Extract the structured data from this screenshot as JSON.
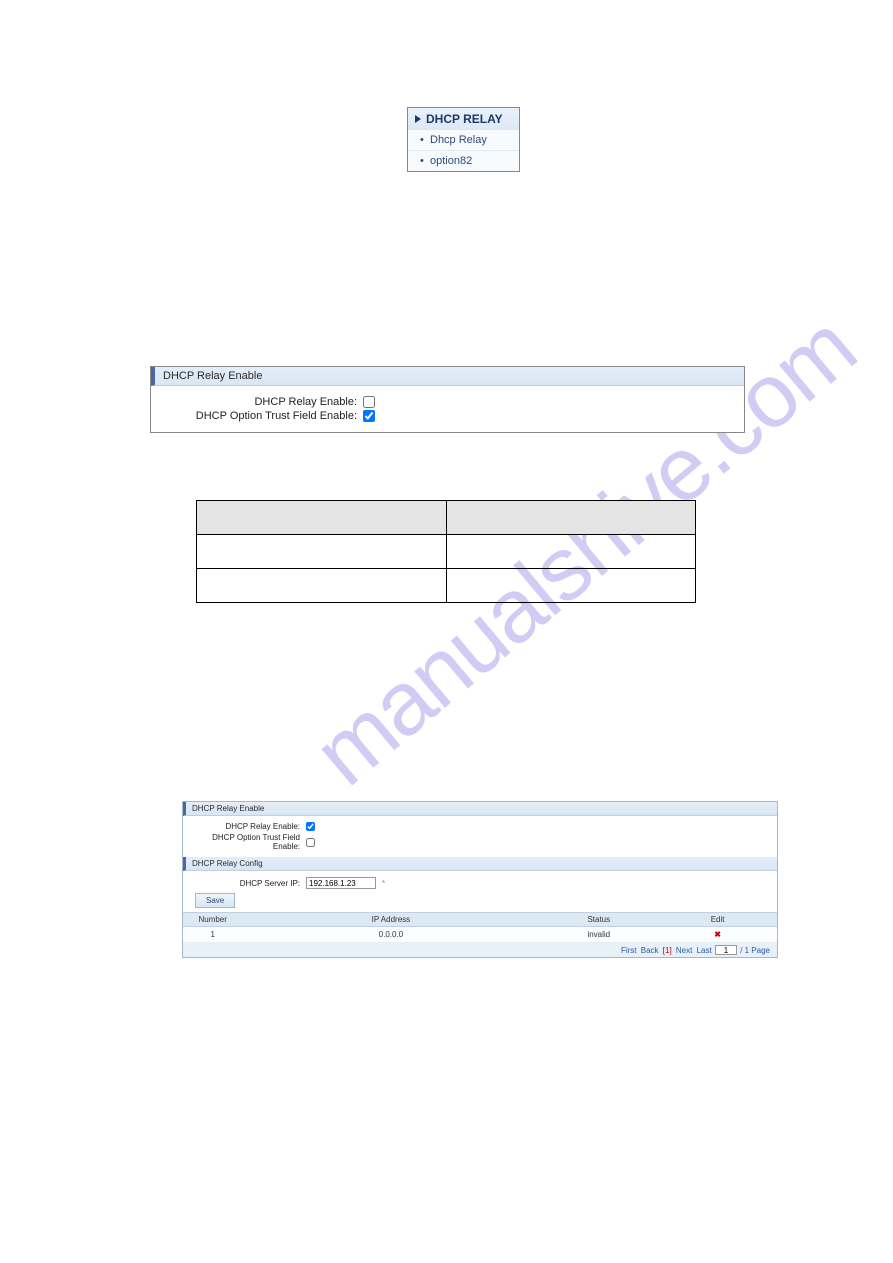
{
  "watermark": "manualshive.com",
  "menu": {
    "title": "DHCP RELAY",
    "items": [
      "Dhcp Relay",
      "option82"
    ]
  },
  "panel1": {
    "header": "DHCP Relay Enable",
    "rows": [
      {
        "label": "DHCP Relay Enable:",
        "checked": false
      },
      {
        "label": "DHCP Option Trust Field Enable:",
        "checked": true
      }
    ]
  },
  "panel2": {
    "enable_header": "DHCP Relay Enable",
    "enable_rows": [
      {
        "label": "DHCP Relay Enable:",
        "checked": true
      },
      {
        "label": "DHCP Option Trust Field Enable:",
        "checked": false
      }
    ],
    "config_header": "DHCP Relay Config",
    "server_label": "DHCP Server IP:",
    "server_value": "192.168.1.23",
    "save_label": "Save",
    "table": {
      "headers": [
        "Number",
        "IP Address",
        "Status",
        "Edit"
      ],
      "rows": [
        {
          "number": "1",
          "ip": "0.0.0.0",
          "status": "invalid"
        }
      ]
    },
    "pager": {
      "first": "First",
      "back": "Back",
      "current": "[1]",
      "next": "Next",
      "last": "Last",
      "page_input": "1",
      "total": "/ 1 Page"
    }
  }
}
